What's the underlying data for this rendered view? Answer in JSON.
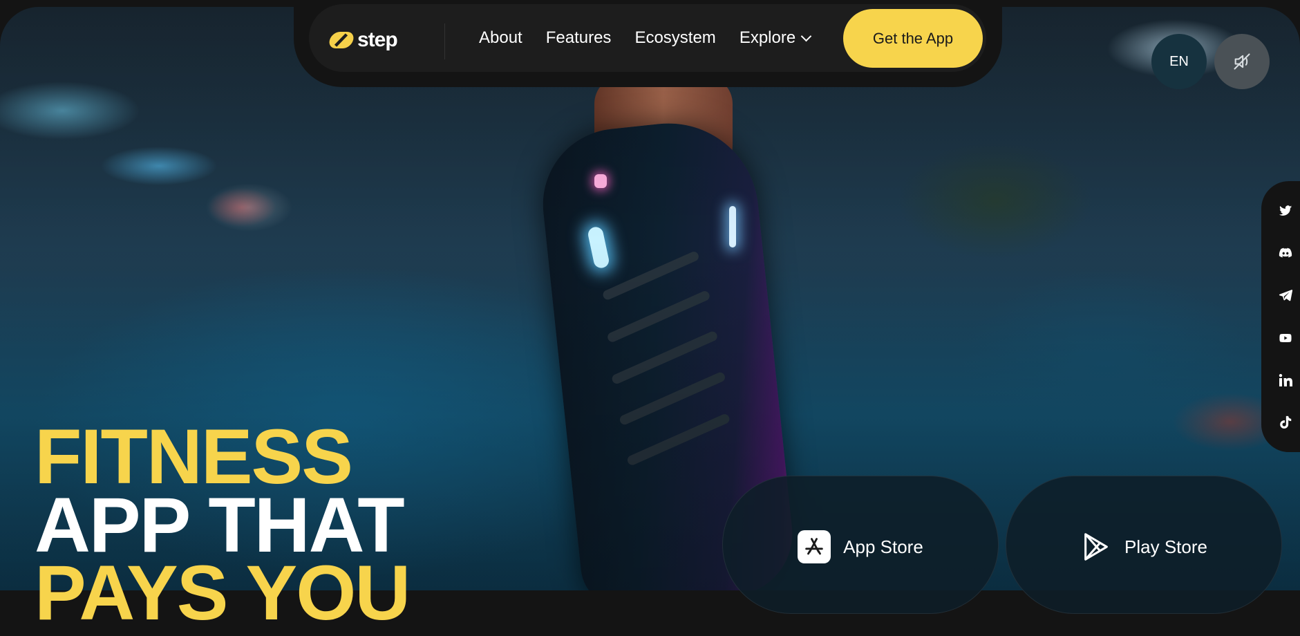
{
  "header": {
    "logo_text": "step",
    "nav": [
      {
        "label": "About"
      },
      {
        "label": "Features"
      },
      {
        "label": "Ecosystem"
      },
      {
        "label": "Explore"
      }
    ],
    "cta_label": "Get the App"
  },
  "controls": {
    "language": "EN",
    "sound_icon": "speaker-muted-icon"
  },
  "social": [
    "twitter-icon",
    "discord-icon",
    "telegram-icon",
    "youtube-icon",
    "linkedin-icon",
    "tiktok-icon"
  ],
  "hero": {
    "line1": "FITNESS",
    "line2": "APP THAT",
    "line3": "PAYS YOU"
  },
  "stores": {
    "app_store": "App Store",
    "play_store": "Play Store"
  },
  "colors": {
    "accent": "#f7d44c",
    "nav_bg": "#1d1d1d",
    "page_bg": "#141414"
  }
}
